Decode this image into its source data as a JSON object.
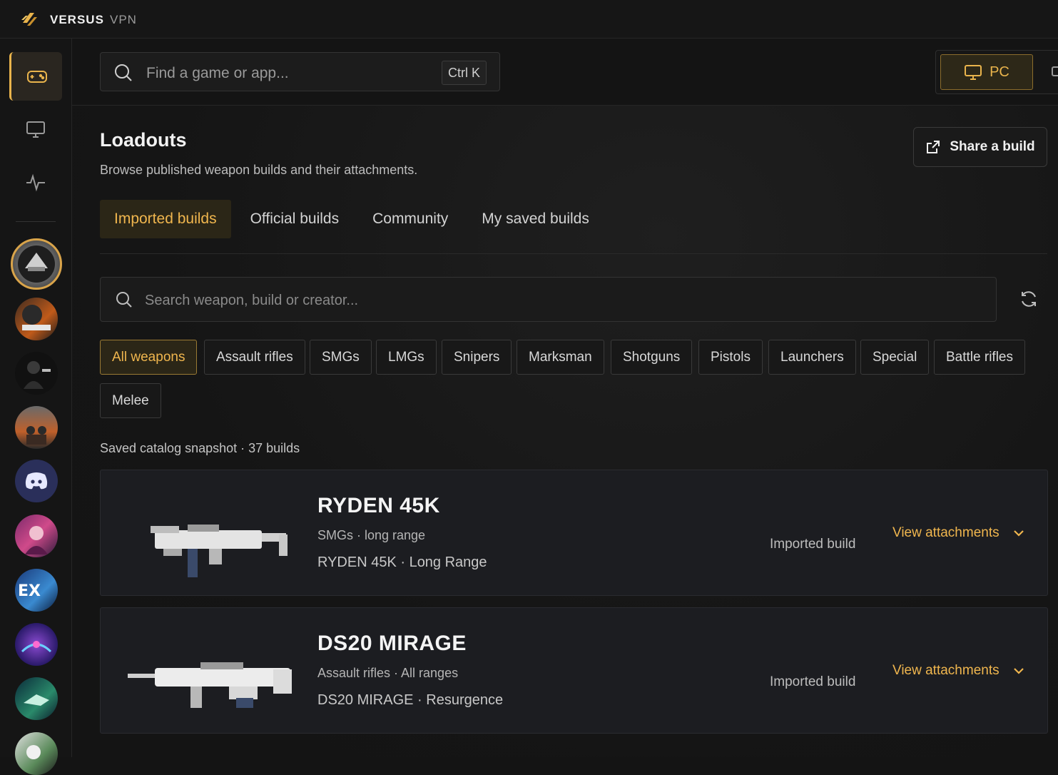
{
  "app": {
    "brand": "VERSUS",
    "brand_sub": "VPN"
  },
  "top_search": {
    "placeholder": "Find a game or app...",
    "shortcut": "Ctrl K"
  },
  "platform": {
    "selected": "PC"
  },
  "page": {
    "title": "Loadouts",
    "subtitle": "Browse published weapon builds and their attachments.",
    "share_label": "Share a build"
  },
  "tabs": [
    {
      "label": "Imported builds",
      "active": true
    },
    {
      "label": "Official builds",
      "active": false
    },
    {
      "label": "Community",
      "active": false
    },
    {
      "label": "My saved builds",
      "active": false
    }
  ],
  "weapon_search": {
    "placeholder": "Search weapon, build or creator..."
  },
  "filters": [
    {
      "label": "All weapons",
      "active": true
    },
    {
      "label": "Assault rifles"
    },
    {
      "label": "SMGs"
    },
    {
      "label": "LMGs"
    },
    {
      "label": "Snipers"
    },
    {
      "label": "Marksman"
    },
    {
      "label": "Shotguns"
    },
    {
      "label": "Pistols"
    },
    {
      "label": "Launchers"
    },
    {
      "label": "Special"
    },
    {
      "label": "Battle rifles"
    },
    {
      "label": "Melee"
    }
  ],
  "catalog_info": "Saved catalog snapshot · 37 builds",
  "builds": [
    {
      "name": "RYDEN 45K",
      "meta": "SMGs · long range",
      "detail": "RYDEN 45K · Long Range",
      "status": "Imported build",
      "action": "View attachments"
    },
    {
      "name": "DS20 MIRAGE",
      "meta": "Assault rifles · All ranges",
      "detail": "DS20 MIRAGE · Resurgence",
      "status": "Imported build",
      "action": "View attachments"
    }
  ],
  "colors": {
    "accent": "#f0b64e",
    "background": "#141414",
    "card": "#1c1d21"
  }
}
